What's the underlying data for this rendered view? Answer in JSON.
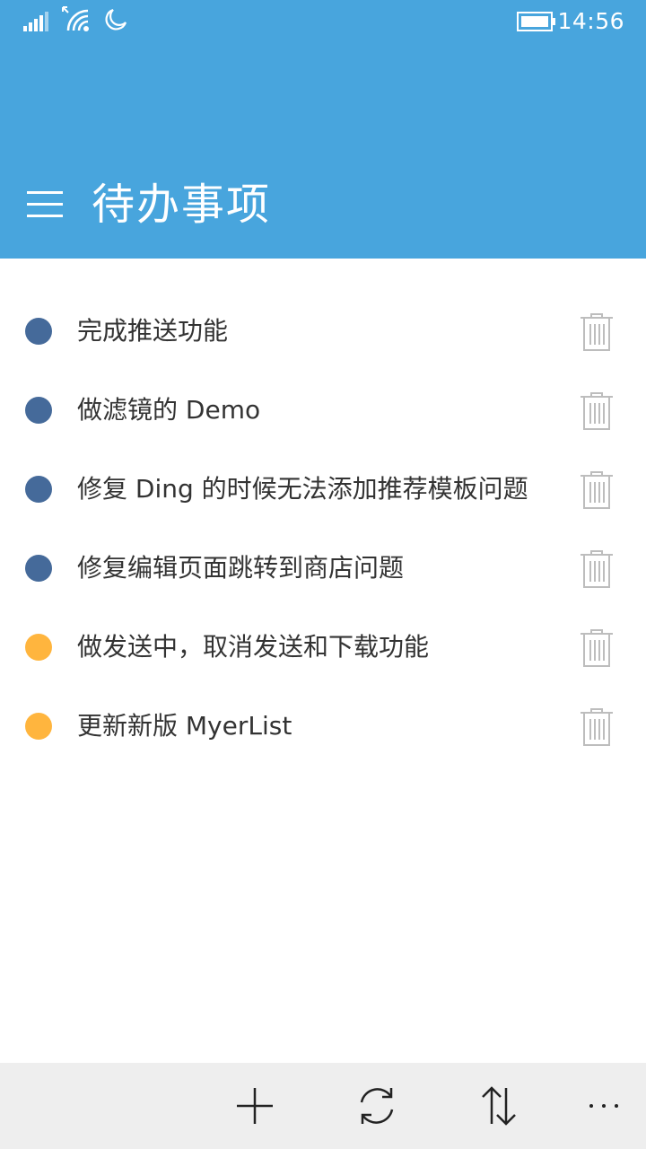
{
  "status_bar": {
    "time": "14:56",
    "icons": [
      "signal-icon",
      "wifi-icon",
      "quiet-hours-icon",
      "battery-icon"
    ]
  },
  "header": {
    "title": "待办事项",
    "background_color": "#48A5DD",
    "menu_icon": "hamburger-menu-icon"
  },
  "todos": [
    {
      "text": "完成推送功能",
      "color": "#456A9A"
    },
    {
      "text": "做滤镜的 Demo",
      "color": "#456A9A"
    },
    {
      "text": "修复 Ding 的时候无法添加推荐模板问题",
      "color": "#456A9A"
    },
    {
      "text": "修复编辑页面跳转到商店问题",
      "color": "#456A9A"
    },
    {
      "text": "做发送中，取消发送和下载功能",
      "color": "#FFB53E"
    },
    {
      "text": "更新新版 MyerList",
      "color": "#FFB53E"
    }
  ],
  "app_bar": {
    "icons": [
      "add-icon",
      "sync-icon",
      "sort-icon",
      "more-icon"
    ]
  }
}
